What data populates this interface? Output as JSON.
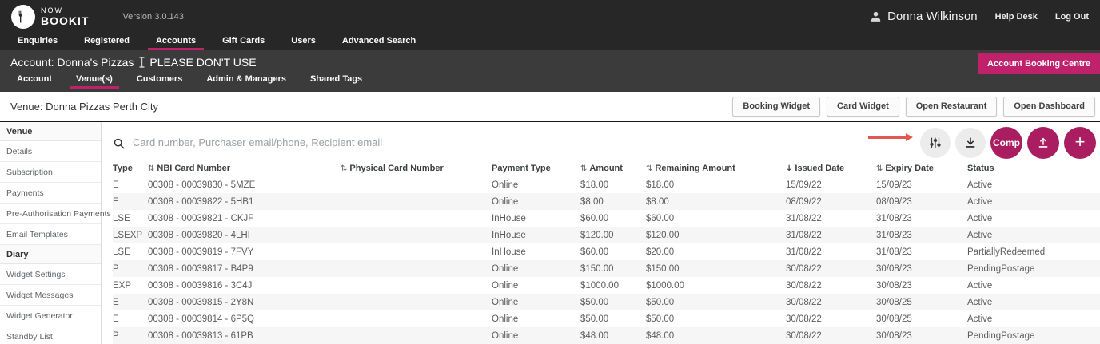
{
  "colors": {
    "accent_pink": "#c0216b",
    "circle_pink": "#ab1d61",
    "header_dark": "#272727",
    "bar_gray": "#3b3b3b",
    "annotation_arrow_red": "#e2574e"
  },
  "header": {
    "logo_line1": "NOW",
    "logo_line2": "BOOKIT",
    "version": "Version 3.0.143",
    "user": "Donna Wilkinson",
    "help_desk": "Help Desk",
    "log_out": "Log Out",
    "nav": [
      {
        "label": "Enquiries",
        "active": false
      },
      {
        "label": "Registered",
        "active": false
      },
      {
        "label": "Accounts",
        "active": true
      },
      {
        "label": "Gift Cards",
        "active": false
      },
      {
        "label": "Users",
        "active": false
      },
      {
        "label": "Advanced Search",
        "active": false
      }
    ]
  },
  "account_bar": {
    "title_prefix": "Account: Donna's Pizzas",
    "title_suffix": "PLEASE DON'T USE",
    "booking_centre_button": "Account Booking Centre",
    "tabs": [
      {
        "label": "Account",
        "active": false
      },
      {
        "label": "Venue(s)",
        "active": true
      },
      {
        "label": "Customers",
        "active": false
      },
      {
        "label": "Admin & Managers",
        "active": false
      },
      {
        "label": "Shared Tags",
        "active": false
      }
    ]
  },
  "venue_bar": {
    "title": "Venue: Donna Pizzas Perth City",
    "buttons": [
      "Booking Widget",
      "Card Widget",
      "Open Restaurant",
      "Open Dashboard"
    ]
  },
  "sidebar": {
    "sections": [
      {
        "header": "Venue",
        "items": [
          "Details",
          "Subscription",
          "Payments",
          "Pre-Authorisation Payments",
          "Email Templates"
        ]
      },
      {
        "header": "Diary",
        "items": [
          "Widget Settings",
          "Widget Messages",
          "Widget Generator",
          "Standby List"
        ]
      }
    ]
  },
  "toolbar": {
    "search_placeholder": "Card number, Purchaser email/phone, Recipient email",
    "comp_label": "Comp",
    "icons": [
      "search-icon",
      "filter-sliders-icon",
      "download-icon",
      "comp-button",
      "upload-icon",
      "plus-icon"
    ],
    "annotation": "red arrow pointing to filter-sliders button"
  },
  "table": {
    "columns": [
      {
        "label": "Type",
        "sort": null
      },
      {
        "label": "NBI Card Number",
        "sort": "both"
      },
      {
        "label": "Physical Card Number",
        "sort": "both"
      },
      {
        "label": "Payment Type",
        "sort": null
      },
      {
        "label": "Amount",
        "sort": "both"
      },
      {
        "label": "Remaining Amount",
        "sort": "both"
      },
      {
        "label": "Issued Date",
        "sort": "desc"
      },
      {
        "label": "Expiry Date",
        "sort": "both"
      },
      {
        "label": "Status",
        "sort": null
      }
    ],
    "rows": [
      [
        "E",
        "00308 - 00039830 - 5MZE",
        "",
        "Online",
        "$18.00",
        "$18.00",
        "15/09/22",
        "15/09/23",
        "Active"
      ],
      [
        "E",
        "00308 - 00039822 - 5HB1",
        "",
        "Online",
        "$8.00",
        "$8.00",
        "08/09/22",
        "08/09/23",
        "Active"
      ],
      [
        "LSE",
        "00308 - 00039821 - CKJF",
        "",
        "InHouse",
        "$60.00",
        "$60.00",
        "31/08/22",
        "31/08/23",
        "Active"
      ],
      [
        "LSEXP",
        "00308 - 00039820 - 4LHI",
        "",
        "InHouse",
        "$120.00",
        "$120.00",
        "31/08/22",
        "31/08/23",
        "Active"
      ],
      [
        "LSE",
        "00308 - 00039819 - 7FVY",
        "",
        "InHouse",
        "$60.00",
        "$20.00",
        "31/08/22",
        "31/08/23",
        "PartiallyRedeemed"
      ],
      [
        "P",
        "00308 - 00039817 - B4P9",
        "",
        "Online",
        "$150.00",
        "$150.00",
        "30/08/22",
        "30/08/23",
        "PendingPostage"
      ],
      [
        "EXP",
        "00308 - 00039816 - 3C4J",
        "",
        "Online",
        "$1000.00",
        "$1000.00",
        "30/08/22",
        "30/08/23",
        "Active"
      ],
      [
        "E",
        "00308 - 00039815 - 2Y8N",
        "",
        "Online",
        "$50.00",
        "$50.00",
        "30/08/22",
        "30/08/25",
        "Active"
      ],
      [
        "E",
        "00308 - 00039814 - 6P5Q",
        "",
        "Online",
        "$50.00",
        "$50.00",
        "30/08/22",
        "30/08/25",
        "Active"
      ],
      [
        "P",
        "00308 - 00039813 - 61PB",
        "",
        "Online",
        "$48.00",
        "$48.00",
        "30/08/22",
        "30/08/23",
        "PendingPostage"
      ]
    ]
  }
}
